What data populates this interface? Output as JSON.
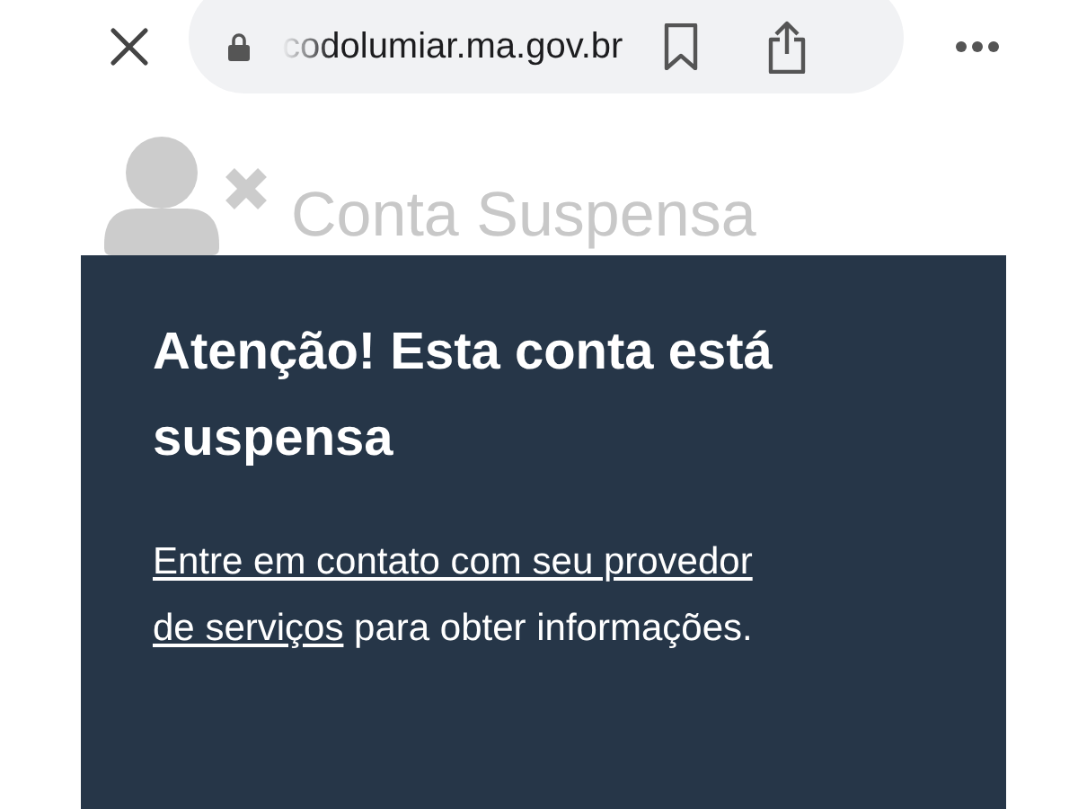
{
  "browser_bar": {
    "url": "codolumiar.ma.gov.br"
  },
  "page": {
    "header": "Conta Suspensa",
    "notice": {
      "title": "Atenção! Esta conta está suspensa",
      "link_lines": [
        "Entre em contato com seu provedor",
        "de serviços"
      ],
      "text": " para obter informações."
    }
  }
}
